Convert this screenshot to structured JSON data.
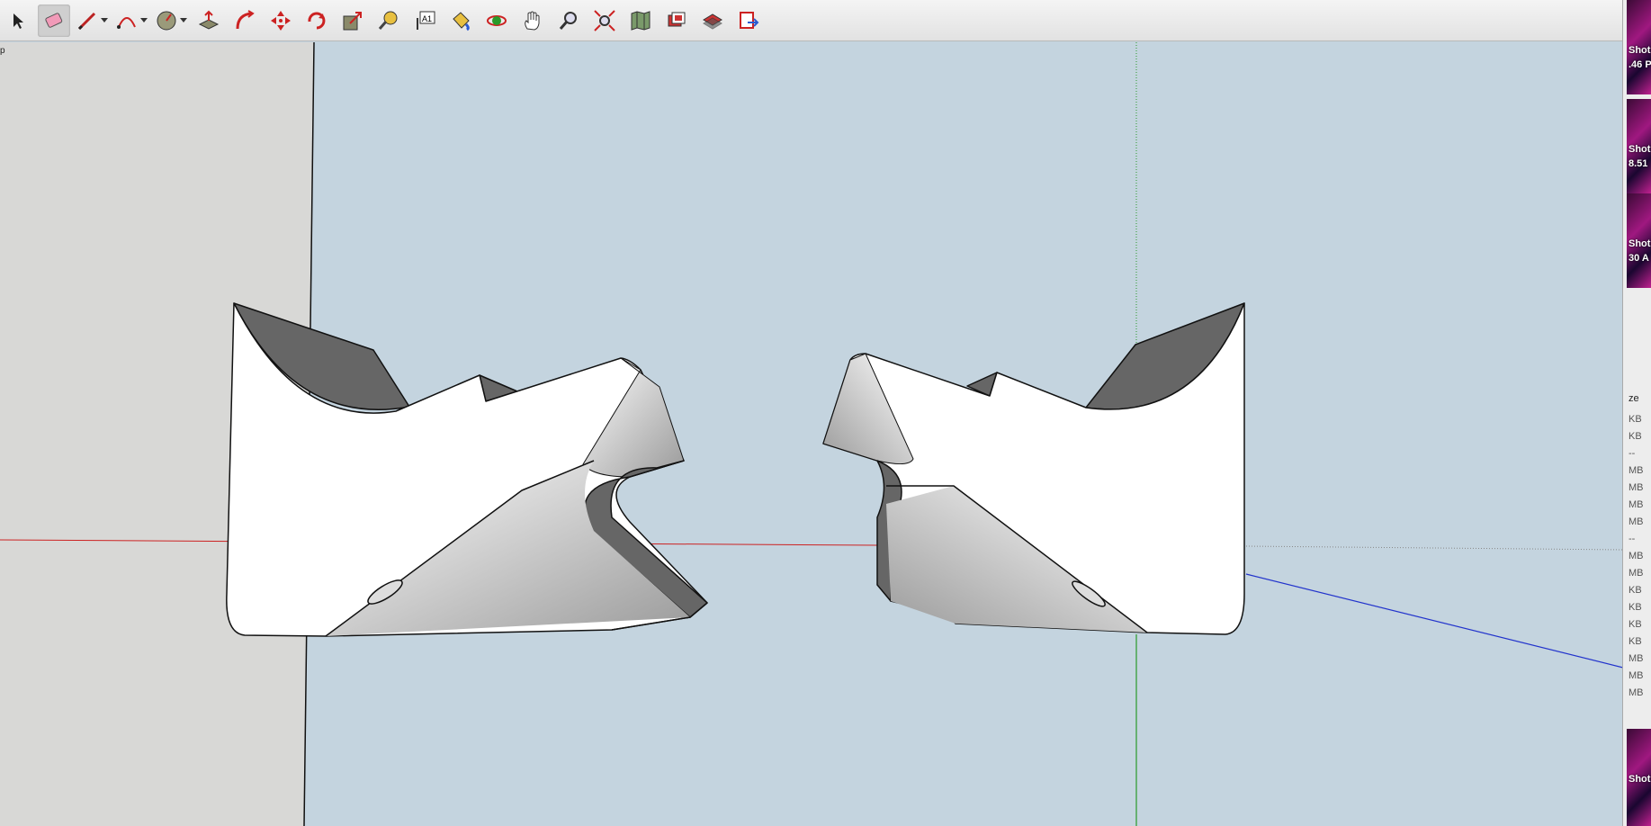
{
  "toolbar": {
    "tools": [
      {
        "name": "select-tool",
        "icon": "arrow-cursor-icon",
        "active": false
      },
      {
        "name": "eraser-tool",
        "icon": "eraser-icon",
        "active": true
      },
      {
        "name": "line-tool",
        "icon": "pencil-icon",
        "active": false,
        "dropdown": true
      },
      {
        "name": "arc-tool",
        "icon": "arc-icon",
        "active": false,
        "dropdown": true
      },
      {
        "name": "circle-tool",
        "icon": "circle-icon",
        "active": false,
        "dropdown": true
      },
      {
        "name": "push-pull-tool",
        "icon": "push-pull-icon",
        "active": false
      },
      {
        "name": "follow-me-tool",
        "icon": "follow-me-icon",
        "active": false
      },
      {
        "name": "move-tool",
        "icon": "move-icon",
        "active": false
      },
      {
        "name": "rotate-tool",
        "icon": "rotate-icon",
        "active": false
      },
      {
        "name": "scale-tool",
        "icon": "scale-icon",
        "active": false
      },
      {
        "name": "tape-measure-tool",
        "icon": "tape-measure-icon",
        "active": false
      },
      {
        "name": "text-tool",
        "icon": "text-icon",
        "active": false
      },
      {
        "name": "paint-bucket-tool",
        "icon": "paint-bucket-icon",
        "active": false
      },
      {
        "name": "orbit-tool",
        "icon": "orbit-icon",
        "active": false
      },
      {
        "name": "pan-tool",
        "icon": "hand-icon",
        "active": false
      },
      {
        "name": "zoom-tool",
        "icon": "magnifier-icon",
        "active": false
      },
      {
        "name": "zoom-extents-tool",
        "icon": "zoom-extents-icon",
        "active": false
      },
      {
        "name": "warehouse-tool",
        "icon": "map-icon",
        "active": false
      },
      {
        "name": "components-tool",
        "icon": "components-icon",
        "active": false
      },
      {
        "name": "extension-tool",
        "icon": "extension-icon",
        "active": false
      },
      {
        "name": "send-tool",
        "icon": "send-icon",
        "active": false
      }
    ],
    "text_tool_glyph": "A1"
  },
  "tray_stub_text": "p",
  "sidebar": {
    "shots": [
      {
        "title": "Shot",
        "subtitle": ".46 P"
      },
      {
        "title": "Shot",
        "subtitle": "8.51"
      },
      {
        "title": "Shot",
        "subtitle": "30 A"
      },
      {
        "title": "Shot",
        "subtitle": ""
      }
    ],
    "column_header": "ze",
    "sizes": [
      "KB",
      "KB",
      "--",
      "MB",
      "MB",
      "MB",
      "MB",
      "--",
      "MB",
      "MB",
      "KB",
      "KB",
      "KB",
      "KB",
      "MB",
      "MB",
      "MB"
    ]
  },
  "colors": {
    "sky": "#c4d4df",
    "ground_left": "#d8d8d6",
    "face_white": "#ffffff",
    "face_dark": "#666666",
    "axis_red": "#cc2222",
    "axis_green": "#2a9a2a",
    "axis_blue": "#2233cc"
  }
}
